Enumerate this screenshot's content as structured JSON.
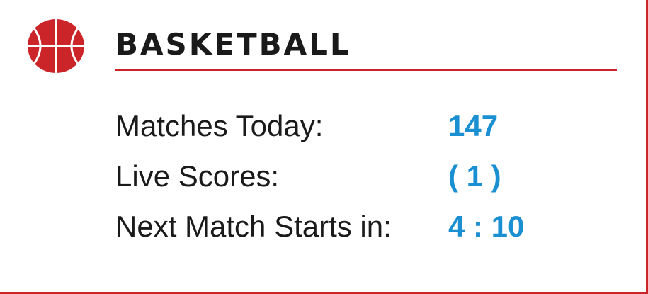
{
  "header": {
    "icon": "basketball-icon",
    "title": "BASKETBALL"
  },
  "stats": [
    {
      "label": "Matches Today:",
      "value": "147"
    },
    {
      "label": "Live Scores:",
      "value": "( 1 )"
    },
    {
      "label": "Next Match Starts in:",
      "value": "4 : 10"
    }
  ],
  "colors": {
    "accent": "#cc2529",
    "value": "#1a8fd1",
    "text": "#1a1a1a"
  }
}
